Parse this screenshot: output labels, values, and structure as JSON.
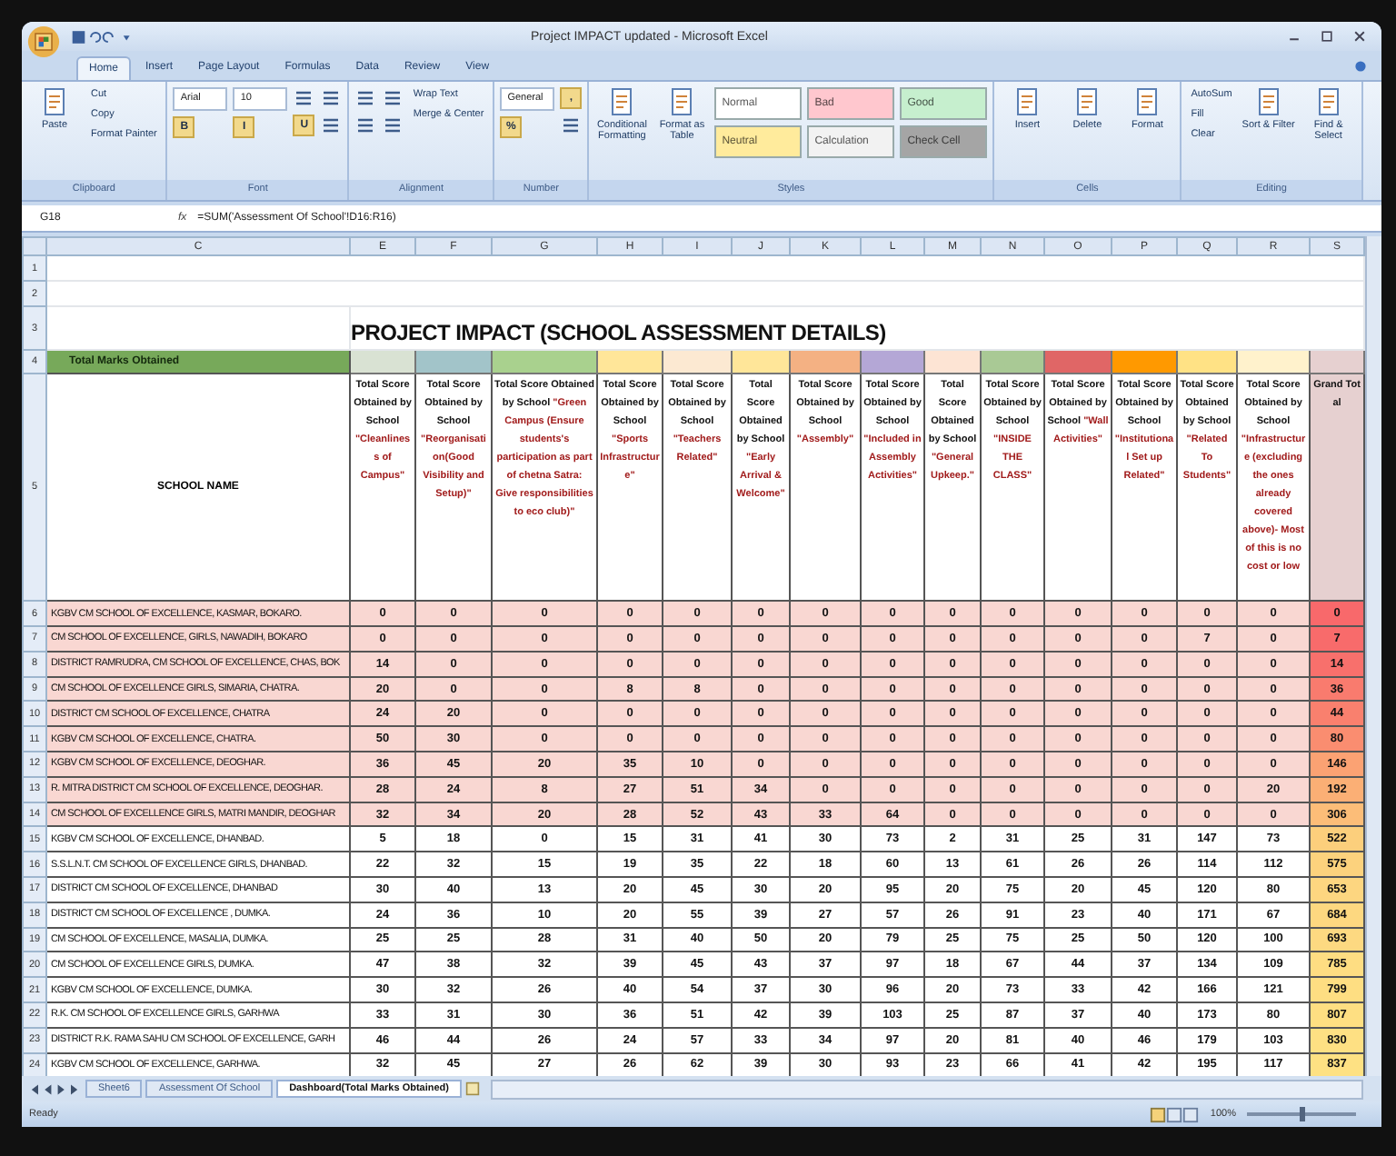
{
  "window": {
    "title": "Project IMPACT  updated - Microsoft Excel"
  },
  "ribbon": {
    "tabs": [
      {
        "label": "Home",
        "selected": true
      },
      {
        "label": "Insert",
        "selected": false
      },
      {
        "label": "Page Layout",
        "selected": false
      },
      {
        "label": "Formulas",
        "selected": false
      },
      {
        "label": "Data",
        "selected": false
      },
      {
        "label": "Review",
        "selected": false
      },
      {
        "label": "View",
        "selected": false
      }
    ],
    "groups": [
      {
        "label": "Clipboard",
        "columns": [
          [
            {
              "kind": "large",
              "label": "Paste"
            }
          ],
          [
            {
              "kind": "small",
              "label": "Cut"
            },
            {
              "kind": "small",
              "label": "Copy"
            },
            {
              "kind": "small",
              "label": "Format Painter"
            }
          ]
        ]
      },
      {
        "label": "Font",
        "columns": [
          [
            {
              "kind": "field",
              "label": "Arial"
            },
            {
              "kind": "glyph",
              "label": "B"
            }
          ],
          [
            {
              "kind": "field",
              "label": "10"
            },
            {
              "kind": "glyph",
              "label": "I"
            }
          ],
          [
            {
              "kind": "tool"
            },
            {
              "kind": "glyph",
              "label": "U"
            }
          ],
          [
            {
              "kind": "tool"
            },
            {
              "kind": "tool"
            }
          ]
        ]
      },
      {
        "label": "Alignment",
        "columns": [
          [
            {
              "kind": "tool"
            },
            {
              "kind": "tool"
            }
          ],
          [
            {
              "kind": "tool"
            },
            {
              "kind": "tool"
            }
          ],
          [
            {
              "kind": "small",
              "label": "Wrap Text"
            },
            {
              "kind": "small",
              "label": "Merge & Center"
            }
          ]
        ]
      },
      {
        "label": "Number",
        "columns": [
          [
            {
              "kind": "field",
              "label": "General"
            },
            {
              "kind": "glyph",
              "label": "%"
            }
          ],
          [
            {
              "kind": "glyph",
              "label": ","
            },
            {
              "kind": "tool"
            }
          ]
        ]
      },
      {
        "label": "Styles",
        "columns": [
          [
            {
              "kind": "large",
              "label": "Conditional Formatting"
            }
          ],
          [
            {
              "kind": "large",
              "label": "Format as Table"
            }
          ],
          [
            {
              "kind": "style",
              "label": "Normal",
              "color": "#ffffff"
            },
            {
              "kind": "style",
              "label": "Neutral",
              "color": "#ffeb9c"
            }
          ],
          [
            {
              "kind": "style",
              "label": "Bad",
              "color": "#ffc7ce"
            },
            {
              "kind": "style",
              "label": "Calculation",
              "color": "#f2f2f2"
            }
          ],
          [
            {
              "kind": "style",
              "label": "Good",
              "color": "#c6efce"
            },
            {
              "kind": "style",
              "label": "Check Cell",
              "color": "#a5a5a5"
            }
          ]
        ]
      },
      {
        "label": "Cells",
        "columns": [
          [
            {
              "kind": "large",
              "label": "Insert"
            }
          ],
          [
            {
              "kind": "large",
              "label": "Delete"
            }
          ],
          [
            {
              "kind": "large",
              "label": "Format"
            }
          ]
        ]
      },
      {
        "label": "Editing",
        "columns": [
          [
            {
              "kind": "small",
              "label": "AutoSum"
            },
            {
              "kind": "small",
              "label": "Fill"
            },
            {
              "kind": "small",
              "label": "Clear"
            }
          ],
          [
            {
              "kind": "large",
              "label": "Sort & Filter"
            }
          ],
          [
            {
              "kind": "large",
              "label": "Find & Select"
            }
          ]
        ]
      }
    ]
  },
  "formula_bar": {
    "name_box": "G18",
    "fx": "fx",
    "formula": "=SUM('Assessment Of School'!D16:R16)"
  },
  "sheet": {
    "column_letters": [
      "C",
      "E",
      "F",
      "G",
      "H",
      "I",
      "J",
      "K",
      "L",
      "M",
      "N",
      "O",
      "P",
      "Q",
      "R",
      "S"
    ],
    "top_row_numbers": [
      "1",
      "2",
      "3",
      "4",
      "5"
    ],
    "title": "PROJECT IMPACT (SCHOOL ASSESSMENT DETAILS)",
    "band_label": "Total Marks Obtained",
    "name_heading": "SCHOOL NAME",
    "columns": [
      {
        "kind": "score",
        "color": "#d9e2d3",
        "heading": "Total Score Obtained by School",
        "topic": "\"Cleanliness of Campus\""
      },
      {
        "kind": "score",
        "color": "#a2c4c9",
        "heading": "Total Score Obtained by School",
        "topic": "\"Reorganisation(Good Visibility and Setup)\""
      },
      {
        "kind": "score",
        "color": "#a9d18e",
        "heading": "Total Score Obtained by School",
        "topic": "\"Green Campus (Ensure students's participation as part of chetna Satra: Give responsibilities to eco club)\""
      },
      {
        "kind": "score",
        "color": "#ffe699",
        "heading": "Total Score Obtained by School",
        "topic": "\"Sports Infrastructure\""
      },
      {
        "kind": "score",
        "color": "#fce9d2",
        "heading": "Total Score Obtained by School",
        "topic": "\"Teachers Related\""
      },
      {
        "kind": "score",
        "color": "#ffe699",
        "heading": "Total Score Obtained by School",
        "topic": "\"Early Arrival & Welcome\""
      },
      {
        "kind": "score",
        "color": "#f4b183",
        "heading": "Total Score Obtained by School",
        "topic": "\"Assembly\""
      },
      {
        "kind": "score",
        "color": "#b4a7d6",
        "heading": "Total Score Obtained by School",
        "topic": "\"Included in Assembly Activities\""
      },
      {
        "kind": "score",
        "color": "#fde4d4",
        "heading": "Total Score Obtained by School",
        "topic": "\"General Upkeep.\""
      },
      {
        "kind": "score",
        "color": "#a9c995",
        "heading": "Total Score Obtained by School",
        "topic": "\"INSIDE THE CLASS\""
      },
      {
        "kind": "score",
        "color": "#e06666",
        "heading": "Total Score Obtained by School",
        "topic": "\"Wall Activities\""
      },
      {
        "kind": "score",
        "color": "#ff9900",
        "heading": "Total Score Obtained by School",
        "topic": "\"Institutional Set up Related\""
      },
      {
        "kind": "score",
        "color": "#ffe285",
        "heading": "Total Score Obtained by School",
        "topic": "\"Related To Students\""
      },
      {
        "kind": "score",
        "color": "#fff2cc",
        "heading": "Total Score Obtained by School",
        "topic": "\"Infrastructure (excluding the ones already covered above)- Most of this is no cost or low"
      },
      {
        "kind": "total",
        "color": "#e6d0d0",
        "heading": "Grand Total"
      }
    ],
    "rows": [
      {
        "number": "6",
        "school": "KGBV CM SCHOOL OF EXCELLENCE, KASMAR, BOKARO.",
        "highlighted": true,
        "scores": [
          "0",
          "0",
          "0",
          "0",
          "0",
          "0",
          "0",
          "0",
          "0",
          "0",
          "0",
          "0",
          "0",
          "0"
        ],
        "grand_total": "0",
        "color": "#f8696b"
      },
      {
        "number": "7",
        "school": "CM SCHOOL OF EXCELLENCE, GIRLS, NAWADIH, BOKARO",
        "highlighted": true,
        "scores": [
          "0",
          "0",
          "0",
          "0",
          "0",
          "0",
          "0",
          "0",
          "0",
          "0",
          "0",
          "0",
          "7",
          "0"
        ],
        "grand_total": "7",
        "color": "#f86b6b"
      },
      {
        "number": "8",
        "school": "DISTRICT RAMRUDRA, CM SCHOOL OF EXCELLENCE, CHAS, BOK",
        "highlighted": true,
        "scores": [
          "14",
          "0",
          "0",
          "0",
          "0",
          "0",
          "0",
          "0",
          "0",
          "0",
          "0",
          "0",
          "0",
          "0"
        ],
        "grand_total": "14",
        "color": "#f8706c"
      },
      {
        "number": "9",
        "school": "CM SCHOOL OF EXCELLENCE GIRLS, SIMARIA, CHATRA.",
        "highlighted": true,
        "scores": [
          "20",
          "0",
          "0",
          "8",
          "8",
          "0",
          "0",
          "0",
          "0",
          "0",
          "0",
          "0",
          "0",
          "0"
        ],
        "grand_total": "36",
        "color": "#f97b6e"
      },
      {
        "number": "10",
        "school": "DISTRICT CM SCHOOL OF EXCELLENCE, CHATRA",
        "highlighted": true,
        "scores": [
          "24",
          "20",
          "0",
          "0",
          "0",
          "0",
          "0",
          "0",
          "0",
          "0",
          "0",
          "0",
          "0",
          "0"
        ],
        "grand_total": "44",
        "color": "#f9806e"
      },
      {
        "number": "11",
        "school": "KGBV CM SCHOOL OF EXCELLENCE, CHATRA.",
        "highlighted": true,
        "scores": [
          "50",
          "30",
          "0",
          "0",
          "0",
          "0",
          "0",
          "0",
          "0",
          "0",
          "0",
          "0",
          "0",
          "0"
        ],
        "grand_total": "80",
        "color": "#fa8d70"
      },
      {
        "number": "12",
        "school": "KGBV CM SCHOOL OF EXCELLENCE, DEOGHAR.",
        "highlighted": true,
        "scores": [
          "36",
          "45",
          "20",
          "35",
          "10",
          "0",
          "0",
          "0",
          "0",
          "0",
          "0",
          "0",
          "0",
          "0"
        ],
        "grand_total": "146",
        "color": "#fba273"
      },
      {
        "number": "13",
        "school": "R. MITRA DISTRICT CM SCHOOL OF EXCELLENCE, DEOGHAR.",
        "highlighted": true,
        "scores": [
          "28",
          "24",
          "8",
          "27",
          "51",
          "34",
          "0",
          "0",
          "0",
          "0",
          "0",
          "0",
          "0",
          "20"
        ],
        "grand_total": "192",
        "color": "#fbaf75"
      },
      {
        "number": "14",
        "school": "CM SCHOOL OF EXCELLENCE GIRLS, MATRI MANDIR, DEOGHAR",
        "highlighted": true,
        "scores": [
          "32",
          "34",
          "20",
          "28",
          "52",
          "43",
          "33",
          "64",
          "0",
          "0",
          "0",
          "0",
          "0",
          "0"
        ],
        "grand_total": "306",
        "color": "#fcbd78"
      },
      {
        "number": "15",
        "school": "KGBV CM SCHOOL OF EXCELLENCE, DHANBAD.",
        "highlighted": false,
        "scores": [
          "5",
          "18",
          "0",
          "15",
          "31",
          "41",
          "30",
          "73",
          "2",
          "31",
          "25",
          "31",
          "147",
          "73"
        ],
        "grand_total": "522",
        "color": "#fccf7c"
      },
      {
        "number": "16",
        "school": "S.S.L.N.T. CM SCHOOL OF EXCELLENCE GIRLS, DHANBAD.",
        "highlighted": false,
        "scores": [
          "22",
          "32",
          "15",
          "19",
          "35",
          "22",
          "18",
          "60",
          "13",
          "61",
          "26",
          "26",
          "114",
          "112"
        ],
        "grand_total": "575",
        "color": "#fcd27d"
      },
      {
        "number": "17",
        "school": "DISTRICT CM SCHOOL OF EXCELLENCE, DHANBAD",
        "highlighted": false,
        "scores": [
          "30",
          "40",
          "13",
          "20",
          "45",
          "30",
          "20",
          "95",
          "20",
          "75",
          "20",
          "45",
          "120",
          "80"
        ],
        "grand_total": "653",
        "color": "#fdd680"
      },
      {
        "number": "18",
        "school": "DISTRICT CM SCHOOL OF EXCELLENCE , DUMKA.",
        "highlighted": false,
        "scores": [
          "24",
          "36",
          "10",
          "20",
          "55",
          "39",
          "27",
          "57",
          "26",
          "91",
          "23",
          "40",
          "171",
          "67"
        ],
        "grand_total": "684",
        "color": "#fdd880"
      },
      {
        "number": "19",
        "school": "CM SCHOOL OF EXCELLENCE, MASALIA, DUMKA.",
        "highlighted": false,
        "scores": [
          "25",
          "25",
          "28",
          "31",
          "40",
          "50",
          "20",
          "79",
          "25",
          "75",
          "25",
          "50",
          "120",
          "100"
        ],
        "grand_total": "693",
        "color": "#fdd981"
      },
      {
        "number": "20",
        "school": "CM SCHOOL OF EXCELLENCE GIRLS, DUMKA.",
        "highlighted": false,
        "scores": [
          "47",
          "38",
          "32",
          "39",
          "45",
          "43",
          "37",
          "97",
          "18",
          "67",
          "44",
          "37",
          "134",
          "109"
        ],
        "grand_total": "785",
        "color": "#fedd82"
      },
      {
        "number": "21",
        "school": "KGBV CM SCHOOL OF EXCELLENCE, DUMKA.",
        "highlighted": false,
        "scores": [
          "30",
          "32",
          "26",
          "40",
          "54",
          "37",
          "30",
          "96",
          "20",
          "73",
          "33",
          "42",
          "166",
          "121"
        ],
        "grand_total": "799",
        "color": "#fede82"
      },
      {
        "number": "22",
        "school": "R.K. CM SCHOOL OF EXCELLENCE GIRLS, GARHWA",
        "highlighted": false,
        "scores": [
          "33",
          "31",
          "30",
          "36",
          "51",
          "42",
          "39",
          "103",
          "25",
          "87",
          "37",
          "40",
          "173",
          "80"
        ],
        "grand_total": "807",
        "color": "#fedf82"
      },
      {
        "number": "23",
        "school": "DISTRICT R.K. RAMA SAHU CM SCHOOL OF EXCELLENCE, GARH",
        "highlighted": false,
        "scores": [
          "46",
          "44",
          "26",
          "24",
          "57",
          "33",
          "34",
          "97",
          "20",
          "81",
          "40",
          "46",
          "179",
          "103"
        ],
        "grand_total": "830",
        "color": "#fee083"
      },
      {
        "number": "24",
        "school": "KGBV CM SCHOOL OF EXCELLENCE, GARHWA.",
        "highlighted": false,
        "scores": [
          "32",
          "45",
          "27",
          "26",
          "62",
          "39",
          "30",
          "93",
          "23",
          "66",
          "41",
          "42",
          "195",
          "117"
        ],
        "grand_total": "837",
        "color": "#fee183"
      }
    ]
  },
  "sheet_tabs": [
    {
      "label": "Sheet6",
      "selected": false
    },
    {
      "label": "Assessment Of School",
      "selected": false
    },
    {
      "label": "Dashboard(Total Marks Obtained)",
      "selected": true
    }
  ],
  "status_bar": {
    "status": "Ready",
    "zoom": "100%",
    "zoom_slider": {
      "level": 0.5
    }
  }
}
